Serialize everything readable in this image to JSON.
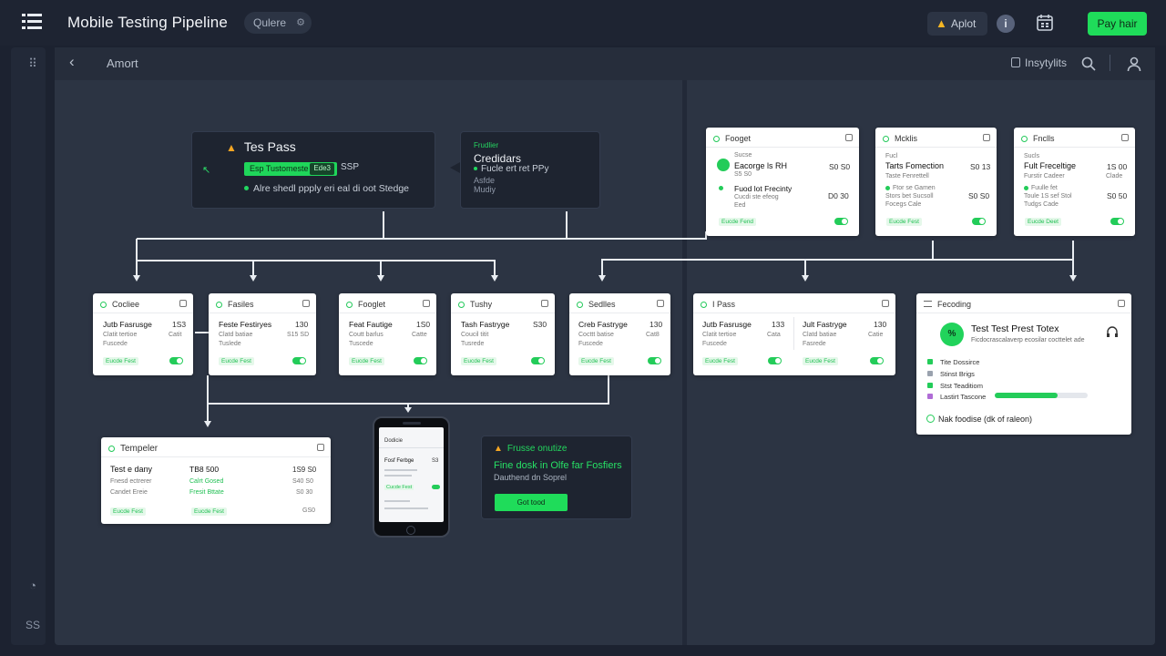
{
  "header": {
    "app_title": "Mobile Testing Pipeline",
    "query_pill": "Qulere",
    "alert_label": "Aplot",
    "pay_button": "Pay hair"
  },
  "subbar": {
    "breadcrumb": "Amort",
    "insights_label": "Insytylits"
  },
  "test_pass": {
    "title": "Tes Pass",
    "field_value": "Esp Tustomeste",
    "field_inner": "Ede3",
    "code": "SSP",
    "note": "Alre shedl ppply eri eal di oot Stedge"
  },
  "creators": {
    "label": "Frudlier",
    "title": "Credidars",
    "row": "Fucle ert ret PPy",
    "sub1": "Asfde",
    "sub2": "Mudiy"
  },
  "top_cards": [
    {
      "name": "Fooget",
      "r1l": "Eacorge ls RH",
      "r1r": "S0 S0",
      "r1s": "S5 S0",
      "r2l": "Fuod lot Frecinty",
      "r2r": "D0 30",
      "r2s1": "Cucdi ste efeog",
      "r2s2": "Eed",
      "tag": "Eucde Fend",
      "pre": "Sucse"
    },
    {
      "name": "Mcklis",
      "r1l": "Tarts Fomection",
      "r1r": "S0 13",
      "pre": "Fucl",
      "r1s": "Taste Fenrettell",
      "r2s1": "Ftor se Gamen",
      "r2s2": "Stors bet Sucsoll",
      "r2s3": "Focegs Cale",
      "r2r": "S0 S0",
      "tag": "Eucde Fest"
    },
    {
      "name": "Fnclls",
      "r1l": "Fult Freceltige",
      "r1r": "1S 00",
      "pre": "Sucls",
      "r1s": "Furstir Cadeer",
      "r2s1": "Fuulle fet",
      "r2s2": "Toule 1S sef Stol",
      "r2s3": "Tudgs Cade",
      "r2r": "S0 50",
      "r2r2": "Clade",
      "tag": "Eucde Deet"
    }
  ],
  "mid_cards": [
    {
      "name": "Cocliee",
      "r1l": "Jutb Fasrusge",
      "r1r": "1S3",
      "s1": "Clatit tertioe",
      "s1r": "Catit",
      "s2": "Fuscede",
      "tag": "Eucde Fest"
    },
    {
      "name": "Fasiles",
      "r1l": "Feste Festiryes",
      "r1r": "130",
      "s1": "Clatd batiae",
      "s1r": "S15 SD",
      "s2": "Tuslede",
      "tag": "Eucde Fest"
    },
    {
      "name": "Fooglet",
      "r1l": "Feat Fautige",
      "r1r": "1S0",
      "s1": "Coutt barlus",
      "s1r": "Catte",
      "s2": "Tuscede",
      "tag": "Eucde Fest"
    },
    {
      "name": "Tushy",
      "r1l": "Tash Fastryge",
      "r1r": "S30",
      "s1": "Coucil titit",
      "s1r": "",
      "s2": "Tusrede",
      "tag": "Eucde Fest"
    },
    {
      "name": "Sedlles",
      "r1l": "Creb Fastryge",
      "r1r": "130",
      "s1": "Cocttt batise",
      "s1r": "Cat8",
      "s2": "Fuscede",
      "tag": "Eucde Fest"
    }
  ],
  "pass_card": {
    "name": "I Pass",
    "left_title": "Jutb Fasrusge",
    "left_num": "133",
    "left_s1": "Clatit tertioe",
    "left_s1r": "Cata",
    "left_s2": "Fuscede",
    "right_title": "Jult Fastryge",
    "right_num": "130",
    "right_s1": "Clatd batiae",
    "right_s1r": "Catie",
    "right_s2": "Fasrede",
    "tag_left": "Eucde Fest",
    "tag_right": "Eucde Fest"
  },
  "reporting": {
    "title": "Fecoding",
    "badge": "%",
    "headline": "Test Test Prest Totex",
    "sub": "Ficdocrascalaverp ecosilar cocttelet ade",
    "rows": [
      "Tite Dossirce",
      "Stinst Brigs",
      "Stst Teaditiom",
      "Lastirt Tascone"
    ],
    "footer": "Nak foodise (dk of raleon)",
    "progress": 0.68
  },
  "templer": {
    "name": "Tempeler",
    "r1l": "Test e dany",
    "r1m": "TB8 500",
    "r1r": "1S9 S0",
    "r2l": "Fnesd ectrerer",
    "r2m": "Calrt Gosed",
    "r2r": "S40 S0",
    "r3l": "Candet Ereie",
    "r3m": "Fresit Bttate",
    "r3r": "S0 30",
    "tag1": "Eucde Fest",
    "tag2": "Eucde Fest",
    "end": "GS0"
  },
  "phone": {
    "title": "Dodicie",
    "row": "Fosf Ferbge",
    "num": "S3",
    "btn": "Cucde Fest"
  },
  "feature": {
    "title": "Frusse onutize",
    "headline": "Fine dosk in Olfe far Fosfiers",
    "sub": "Dauthend dn Soprel",
    "button": "Got tood"
  },
  "sidebar": {
    "bottom_label": "SS"
  }
}
